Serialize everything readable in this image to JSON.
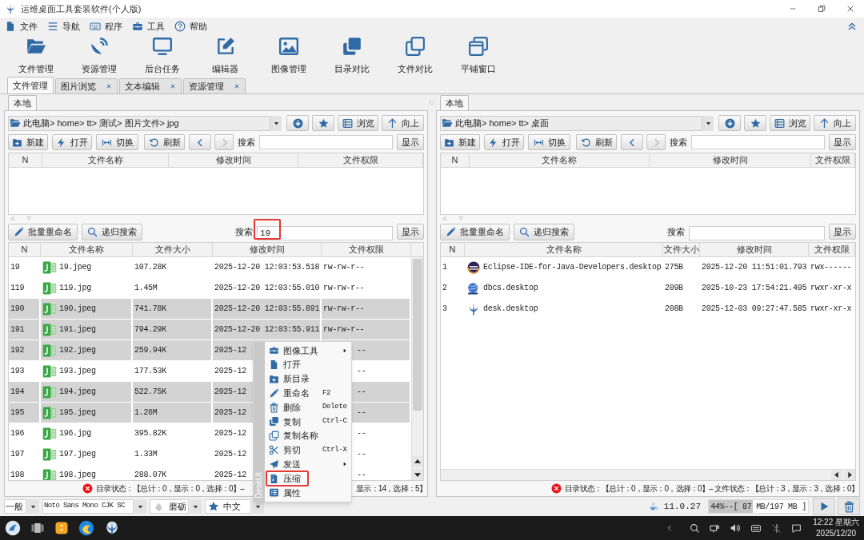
{
  "window": {
    "title": "运维桌面工具套装软件(个人版)"
  },
  "menu": [
    {
      "label": "文件"
    },
    {
      "label": "导航"
    },
    {
      "label": "程序"
    },
    {
      "label": "工具"
    },
    {
      "label": "帮助"
    }
  ],
  "toolbar": [
    {
      "label": "文件管理"
    },
    {
      "label": "资源管理"
    },
    {
      "label": "后台任务"
    },
    {
      "label": "编辑器"
    },
    {
      "label": "图像管理"
    },
    {
      "label": "目录对比"
    },
    {
      "label": "文件对比"
    },
    {
      "label": "平铺窗口"
    }
  ],
  "tabs": [
    {
      "label": "文件管理",
      "selected": true,
      "closable": false
    },
    {
      "label": "图片浏览",
      "selected": false,
      "closable": true
    },
    {
      "label": "文本编辑",
      "selected": false,
      "closable": true
    },
    {
      "label": "资源管理",
      "selected": false,
      "closable": true
    }
  ],
  "panels": [
    {
      "tab": {
        "label": "本地",
        "selected": true
      },
      "path": "此电脑> home> tt> 测试> 图片文件> jpg",
      "path_buttons": [
        "浏览",
        "向上"
      ],
      "actions": [
        "新建",
        "打开",
        "切换",
        "刷新"
      ],
      "search_label": "搜索",
      "show_label": "显示",
      "dir_columns": [
        "N",
        "文件名称",
        "修改时间",
        "文件权限"
      ],
      "file_actions": [
        "批量重命名",
        "递归搜索"
      ],
      "file_search": {
        "label": "搜索",
        "value": "19",
        "highlight": true
      },
      "file_show_label": "显示",
      "file_columns": [
        "N",
        "文件名称",
        "文件大小",
        "修改时间",
        "文件权限"
      ],
      "rows": [
        {
          "n": "19",
          "name": "19.jpeg",
          "size": "107.28K",
          "time": "2025-12-20 12:03:53.518",
          "perm": "rw-rw-r--",
          "selected": false,
          "covered": false
        },
        {
          "n": "119",
          "name": "119.jpg",
          "size": "1.45M",
          "time": "2025-12-20 12:03:55.010",
          "perm": "rw-rw-r--",
          "selected": false,
          "covered": false
        },
        {
          "n": "190",
          "name": "190.jpeg",
          "size": "741.78K",
          "time": "2025-12-20 12:03:55.891",
          "perm": "rw-rw-r--",
          "selected": true,
          "covered": false
        },
        {
          "n": "191",
          "name": "191.jpeg",
          "size": "794.29K",
          "time": "2025-12-20 12:03:55.911",
          "perm": "rw-rw-r--",
          "selected": true,
          "covered": false
        },
        {
          "n": "192",
          "name": "192.jpeg",
          "size": "259.94K",
          "time": "2025-12",
          "perm": "--",
          "selected": true,
          "covered": true
        },
        {
          "n": "193",
          "name": "193.jpeg",
          "size": "177.53K",
          "time": "2025-12",
          "perm": "--",
          "selected": false,
          "covered": true
        },
        {
          "n": "194",
          "name": "194.jpeg",
          "size": "522.75K",
          "time": "2025-12",
          "perm": "--",
          "selected": true,
          "covered": true
        },
        {
          "n": "195",
          "name": "195.jpeg",
          "size": "1.26M",
          "time": "2025-12",
          "perm": "--",
          "selected": true,
          "covered": true
        },
        {
          "n": "196",
          "name": "196.jpg",
          "size": "395.82K",
          "time": "2025-12",
          "perm": "--",
          "selected": false,
          "covered": true
        },
        {
          "n": "197",
          "name": "197.jpeg",
          "size": "1.33M",
          "time": "2025-12",
          "perm": "--",
          "selected": false,
          "covered": true
        },
        {
          "n": "198",
          "name": "198.jpeg",
          "size": "288.07K",
          "time": "2025-12",
          "perm": "--",
          "selected": false,
          "covered": true
        }
      ],
      "status": [
        "目录状态：【总计：0，显示：0，选择：0】--",
        "显示：14，选择：5】"
      ]
    },
    {
      "tab": {
        "label": "本地",
        "selected": true
      },
      "path": "此电脑> home> tt> 桌面",
      "path_buttons": [
        "浏览",
        "向上"
      ],
      "actions": [
        "新建",
        "打开",
        "切换",
        "刷新"
      ],
      "search_label": "搜索",
      "show_label": "显示",
      "dir_columns": [
        "N",
        "文件名称",
        "修改时间",
        "文件权限"
      ],
      "file_actions": [
        "批量重命名",
        "递归搜索"
      ],
      "file_search": {
        "label": "搜索",
        "highlight": false
      },
      "file_show_label": "显示",
      "file_columns": [
        "N",
        "文件名称",
        "文件大小",
        "修改时间",
        "文件权限"
      ],
      "rows": [
        {
          "n": "1",
          "name": "Eclipse-IDE-for-Java-Developers.desktop",
          "size": "275B",
          "time": "2025-12-20 11:51:01.793",
          "perm": "rwx------",
          "selected": false,
          "covered": false
        },
        {
          "n": "2",
          "name": "dbcs.desktop",
          "size": "209B",
          "time": "2025-10-23 17:54:21.495",
          "perm": "rwxr-xr-x",
          "selected": false,
          "covered": false
        },
        {
          "n": "3",
          "name": "desk.desktop",
          "size": "208B",
          "time": "2025-12-03 09:27:47.585",
          "perm": "rwxr-xr-x",
          "selected": false,
          "covered": false
        }
      ],
      "status": [
        "目录状态：【总计：0，显示：0，选择：0】-- 文件状态：【总计：3，显示：3，选择：0】"
      ]
    }
  ],
  "context_menu": {
    "side_label": "DeskUI",
    "items": [
      {
        "label": "图像工具",
        "submenu": true,
        "highlight": false
      },
      {
        "label": "打开",
        "submenu": false,
        "highlight": false
      },
      {
        "label": "新目录",
        "submenu": false,
        "highlight": false
      },
      {
        "label": "重命名",
        "shortcut": "F2",
        "submenu": false,
        "highlight": false
      },
      {
        "label": "删除",
        "shortcut": "Delete",
        "submenu": false,
        "highlight": false
      },
      {
        "label": "复制",
        "shortcut": "Ctrl-C",
        "submenu": false,
        "highlight": false
      },
      {
        "label": "复制名称",
        "submenu": false,
        "highlight": false
      },
      {
        "label": "剪切",
        "shortcut": "Ctrl-X",
        "submenu": false,
        "highlight": false
      },
      {
        "label": "发送",
        "submenu": true,
        "highlight": false
      },
      {
        "label": "压缩",
        "submenu": false,
        "highlight": true
      },
      {
        "label": "属性",
        "submenu": false,
        "highlight": false
      }
    ]
  },
  "bottom": {
    "combos": [
      {
        "value": "一般"
      },
      {
        "value": "Noto Sans Mono CJK SC"
      },
      {
        "value": "磨砺"
      },
      {
        "value": "中文"
      }
    ],
    "java_version": "11.0.27",
    "memory": {
      "text": "44%--[ 87 MB/197 MB ]",
      "level": 0.44
    }
  },
  "taskbar": {
    "time": "12:22 星期六",
    "date": "2025/12/20"
  }
}
